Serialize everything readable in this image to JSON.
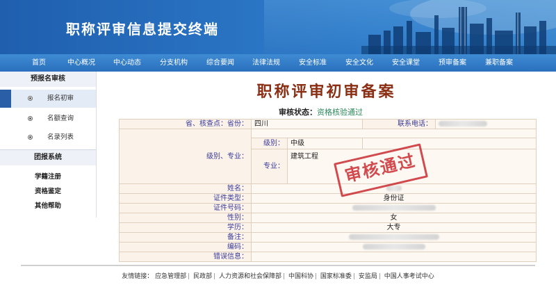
{
  "banner": {
    "title": "职称评审信息提交终端"
  },
  "nav": {
    "items": [
      {
        "label": "首页"
      },
      {
        "label": "中心概况"
      },
      {
        "label": "中心动态"
      },
      {
        "label": "分支机构"
      },
      {
        "label": "综合要闻"
      },
      {
        "label": "法律法规"
      },
      {
        "label": "安全标准"
      },
      {
        "label": "安全文化"
      },
      {
        "label": "安全课堂"
      },
      {
        "label": "预审备案"
      },
      {
        "label": "兼职备案"
      }
    ]
  },
  "sidebar": {
    "section1_title": "预报名审核",
    "items": [
      {
        "label": "报名初审"
      },
      {
        "label": "名额查询"
      },
      {
        "label": "名录列表"
      }
    ],
    "section2_title": "团报系统",
    "links": [
      {
        "label": "学籍注册"
      },
      {
        "label": "资格鉴定"
      },
      {
        "label": "其他帮助"
      }
    ]
  },
  "main": {
    "title": "职称评审初审备案",
    "status_label": "审核状态：",
    "status_value": "资格核验通过",
    "colors": {
      "title": "#8a2e14",
      "status_value": "#2a8a5a",
      "stamp": "#c8242b"
    }
  },
  "form": {
    "province_label": "省、核查点：省份：",
    "province_value": "四川",
    "phone_label": "联系电话：",
    "level_major_label": "级别、专业：",
    "level_label": "级别：",
    "level_value": "中级",
    "major_label": "专业：",
    "major_value": "建筑工程",
    "name_label": "姓名：",
    "id_type_label": "证件类型：",
    "id_type_value": "身份证",
    "id_number_label": "证件号码：",
    "gender_label": "性别：",
    "gender_value": "女",
    "education_label": "学历：",
    "education_value": "大专",
    "remarks_label": "备注：",
    "code_label": "编码：",
    "error_label": "错误信息："
  },
  "stamp": {
    "text": "审核通过"
  },
  "footer": {
    "prefix": "友情链接：",
    "links": [
      {
        "label": "应急管理部"
      },
      {
        "label": "民政部"
      },
      {
        "label": "人力资源和社会保障部"
      },
      {
        "label": "中国科协"
      },
      {
        "label": "国家标准委"
      },
      {
        "label": "安监局"
      },
      {
        "label": "中国人事考试中心"
      }
    ],
    "separator": "|"
  }
}
